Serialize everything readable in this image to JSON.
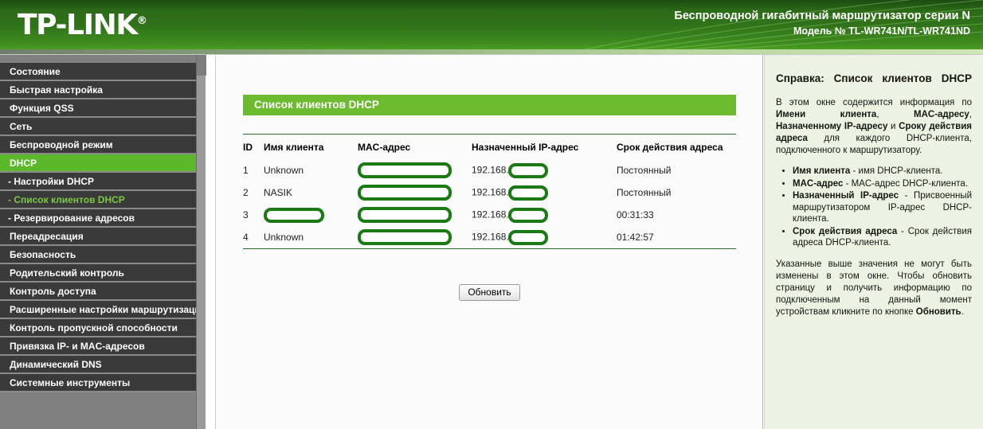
{
  "header": {
    "logo_text": "TP-LINK",
    "logo_registered": "®",
    "product_line": "Беспроводной гигабитный маршрутизатор серии N",
    "model_line": "Модель № TL-WR741N/TL-WR741ND",
    "colors": {
      "green_dark": "#2c6a17",
      "green_light": "#4a9e23"
    }
  },
  "sidebar": {
    "items": [
      {
        "label": "Состояние",
        "state": "normal"
      },
      {
        "label": "Быстрая настройка",
        "state": "normal"
      },
      {
        "label": "Функция QSS",
        "state": "normal"
      },
      {
        "label": "Сеть",
        "state": "normal"
      },
      {
        "label": "Беспроводной режим",
        "state": "normal"
      },
      {
        "label": "DHCP",
        "state": "active"
      },
      {
        "label": "- Настройки DHCP",
        "state": "sub"
      },
      {
        "label": "- Список клиентов DHCP",
        "state": "sub-active"
      },
      {
        "label": "- Резервирование адресов",
        "state": "sub"
      },
      {
        "label": "Переадресация",
        "state": "normal"
      },
      {
        "label": "Безопасность",
        "state": "normal"
      },
      {
        "label": "Родительский контроль",
        "state": "normal"
      },
      {
        "label": "Контроль доступа",
        "state": "normal"
      },
      {
        "label": "Расширенные настройки маршрутизации",
        "state": "normal"
      },
      {
        "label": "Контроль пропускной способности",
        "state": "normal"
      },
      {
        "label": "Привязка IP- и MAC-адресов",
        "state": "normal"
      },
      {
        "label": "Динамический DNS",
        "state": "normal"
      },
      {
        "label": "Системные инструменты",
        "state": "normal"
      }
    ],
    "active_color": "#5cb82a",
    "sub_active_color": "#7ac943"
  },
  "main": {
    "section_title": "Список клиентов DHCP",
    "columns": [
      "ID",
      "Имя клиента",
      "MAC-адрес",
      "Назначенный IP-адрес",
      "Срок действия адреса"
    ],
    "rows": [
      {
        "id": "1",
        "client_name": "Unknown",
        "client_name_redacted": false,
        "mac": "",
        "mac_redacted": true,
        "ip_prefix": "192.168.",
        "ip_redacted": true,
        "lease": "Постоянный"
      },
      {
        "id": "2",
        "client_name": "NASIK",
        "client_name_redacted": false,
        "mac": "",
        "mac_redacted": true,
        "ip_prefix": "192.168.",
        "ip_redacted": true,
        "lease": "Постоянный"
      },
      {
        "id": "3",
        "client_name": "",
        "client_name_redacted": true,
        "mac": "",
        "mac_redacted": true,
        "ip_prefix": "192.168.",
        "ip_redacted": true,
        "lease": "00:31:33"
      },
      {
        "id": "4",
        "client_name": "Unknown",
        "client_name_redacted": false,
        "mac": "",
        "mac_redacted": true,
        "ip_prefix": "192.168.",
        "ip_redacted": true,
        "lease": "01:42:57"
      }
    ],
    "refresh_button": "Обновить"
  },
  "help": {
    "title": "Справка: Список клиентов DHCP",
    "intro_parts": {
      "p1": "В этом окне содержится информация по ",
      "b1": "Имени клиента",
      "p2": ", ",
      "b2": "MAC-адресу",
      "p3": ", ",
      "b3": "Назначенному IP-адресу",
      "p4": " и ",
      "b4": "Сроку действия адреса",
      "p5": " для каждого DHCP-клиента, подключенного к маршрутизатору."
    },
    "bullets": [
      {
        "term": "Имя клиента",
        "desc": " - имя DHCP-клиента."
      },
      {
        "term": "MAC-адрес",
        "desc": " - MAC-адрес DHCP-клиента."
      },
      {
        "term": "Назначенный IP-адрес",
        "desc": " - Присвоенный маршрутизатором IP-адрес DHCP-клиента."
      },
      {
        "term": "Срок действия адреса",
        "desc": " - Срок действия адреса DHCP-клиента."
      }
    ],
    "outro_parts": {
      "p1": "Указанные выше значения не могут быть изменены в этом окне. Чтобы обновить страницу и получить информацию по подключенным на данный момент устройствам кликните по кнопке ",
      "b1": "Обновить",
      "p2": "."
    }
  }
}
